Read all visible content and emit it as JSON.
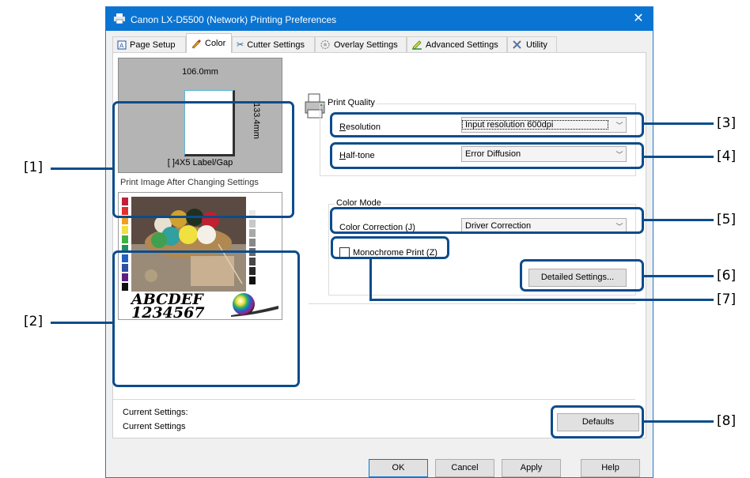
{
  "window": {
    "title": "Canon LX-D5500 (Network) Printing Preferences",
    "close_glyph": "✕"
  },
  "tabs": [
    {
      "label": "Page Setup",
      "icon": "page-setup-icon"
    },
    {
      "label": "Color",
      "icon": "color-icon"
    },
    {
      "label": "Cutter Settings",
      "icon": "cutter-icon"
    },
    {
      "label": "Overlay Settings",
      "icon": "overlay-icon"
    },
    {
      "label": "Advanced Settings",
      "icon": "advanced-icon"
    },
    {
      "label": "Utility",
      "icon": "utility-icon"
    }
  ],
  "preview": {
    "width_text": "106.0mm",
    "height_text": "133.4mm",
    "media_text": "[ ]4X5 Label/Gap",
    "image_caption": "Print Image After Changing Settings",
    "sample_letters": "ABCDEF",
    "sample_digits": "1234567"
  },
  "print_quality": {
    "group_label": "Print Quality",
    "resolution_label": "Resolution",
    "resolution_mnemonic": "R",
    "resolution_value": "Input resolution 600dpi",
    "halftone_label": "Half-tone",
    "halftone_mnemonic": "H",
    "halftone_value": "Error Diffusion"
  },
  "color_mode": {
    "group_label": "Color Mode",
    "correction_label": "Color Correction (J)",
    "correction_value": "Driver Correction",
    "monochrome_label": "Monochrome Print (Z)",
    "monochrome_checked": false,
    "detailed_button": "Detailed Settings..."
  },
  "current": {
    "line1": "Current Settings:",
    "line2": "Current Settings",
    "defaults_button": "Defaults"
  },
  "footer": {
    "ok": "OK",
    "cancel": "Cancel",
    "apply": "Apply",
    "help": "Help"
  },
  "callouts": [
    "[1]",
    "[2]",
    "[3]",
    "[4]",
    "[5]",
    "[6]",
    "[7]",
    "[8]"
  ],
  "colors": {
    "titlebar": "#0a74d3",
    "callout": "#0c4c8c"
  }
}
